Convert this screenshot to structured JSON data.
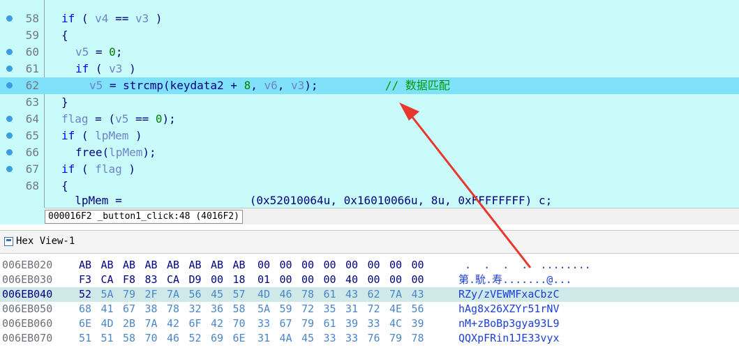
{
  "code_lines": [
    {
      "num": "58",
      "dot": true,
      "hl": false,
      "indent": 0,
      "tokens": [
        [
          "kw",
          "if"
        ],
        [
          "plain",
          " ( "
        ],
        [
          "var",
          "v4"
        ],
        [
          "plain",
          " == "
        ],
        [
          "var",
          "v3"
        ],
        [
          "plain",
          " )"
        ]
      ]
    },
    {
      "num": "59",
      "dot": false,
      "hl": false,
      "indent": 0,
      "tokens": [
        [
          "plain",
          "{"
        ]
      ]
    },
    {
      "num": "60",
      "dot": true,
      "hl": false,
      "indent": 1,
      "tokens": [
        [
          "var",
          "v5"
        ],
        [
          "plain",
          " = "
        ],
        [
          "num",
          "0"
        ],
        [
          "plain",
          ";"
        ]
      ]
    },
    {
      "num": "61",
      "dot": true,
      "hl": false,
      "indent": 1,
      "tokens": [
        [
          "kw",
          "if"
        ],
        [
          "plain",
          " ( "
        ],
        [
          "var",
          "v3"
        ],
        [
          "plain",
          " )"
        ]
      ]
    },
    {
      "num": "62",
      "dot": true,
      "hl": true,
      "indent": 2,
      "tokens": [
        [
          "var",
          "v5"
        ],
        [
          "plain",
          " = "
        ],
        [
          "func",
          "strcmp"
        ],
        [
          "plain",
          "(keydata2 + "
        ],
        [
          "num",
          "8"
        ],
        [
          "plain",
          ", "
        ],
        [
          "var",
          "v6"
        ],
        [
          "plain",
          ", "
        ],
        [
          "var",
          "v3"
        ],
        [
          "plain",
          ");          "
        ],
        [
          "cmt",
          "// 数据匹配"
        ]
      ]
    },
    {
      "num": "63",
      "dot": false,
      "hl": false,
      "indent": 0,
      "tokens": [
        [
          "plain",
          "}"
        ]
      ]
    },
    {
      "num": "64",
      "dot": true,
      "hl": false,
      "indent": 0,
      "tokens": [
        [
          "var",
          "flag"
        ],
        [
          "plain",
          " = ("
        ],
        [
          "var",
          "v5"
        ],
        [
          "plain",
          " == "
        ],
        [
          "num",
          "0"
        ],
        [
          "plain",
          ");"
        ]
      ]
    },
    {
      "num": "65",
      "dot": true,
      "hl": false,
      "indent": 0,
      "tokens": [
        [
          "kw",
          "if"
        ],
        [
          "plain",
          " ( "
        ],
        [
          "var",
          "lpMem"
        ],
        [
          "plain",
          " )"
        ]
      ]
    },
    {
      "num": "66",
      "dot": true,
      "hl": false,
      "indent": 1,
      "tokens": [
        [
          "func",
          "free"
        ],
        [
          "plain",
          "("
        ],
        [
          "var",
          "lpMem"
        ],
        [
          "plain",
          ");"
        ]
      ]
    },
    {
      "num": "67",
      "dot": true,
      "hl": false,
      "indent": 0,
      "tokens": [
        [
          "kw",
          "if"
        ],
        [
          "plain",
          " ( "
        ],
        [
          "var",
          "flag"
        ],
        [
          "plain",
          " )"
        ]
      ]
    },
    {
      "num": "68",
      "dot": false,
      "hl": false,
      "indent": 0,
      "tokens": [
        [
          "plain",
          "{"
        ]
      ]
    }
  ],
  "cut_line": "  lpMem =                   (0x52010064u, 0x16010066u, 8u, 0xFFFFFFFF) c;",
  "status_text": "000016F2 _button1_click:48 (4016F2)",
  "hex_title": "Hex View-1",
  "hex_rows": [
    {
      "addr": "006EB020",
      "hl": false,
      "bytes": [
        "AB",
        "AB",
        "AB",
        "AB",
        "AB",
        "AB",
        "AB",
        "AB",
        "00",
        "00",
        "00",
        "00",
        "00",
        "00",
        "00",
        "00"
      ],
      "ascii": " .  .  .  .  ........"
    },
    {
      "addr": "006EB030",
      "hl": false,
      "bytes": [
        "F3",
        "CA",
        "F8",
        "83",
        "CA",
        "D9",
        "00",
        "18",
        "01",
        "00",
        "00",
        "00",
        "40",
        "00",
        "00",
        "00"
      ],
      "ascii": "第.馻.寿.......@..."
    },
    {
      "addr": "006EB040",
      "hl": true,
      "bytes": [
        "52",
        "5A",
        "79",
        "2F",
        "7A",
        "56",
        "45",
        "57",
        "4D",
        "46",
        "78",
        "61",
        "43",
        "62",
        "7A",
        "43"
      ],
      "ascii": "RZy/zVEWMFxaCbzC"
    },
    {
      "addr": "006EB050",
      "hl": false,
      "bytes": [
        "68",
        "41",
        "67",
        "38",
        "78",
        "32",
        "36",
        "58",
        "5A",
        "59",
        "72",
        "35",
        "31",
        "72",
        "4E",
        "56"
      ],
      "ascii": "hAg8x26XZYr51rNV"
    },
    {
      "addr": "006EB060",
      "hl": false,
      "bytes": [
        "6E",
        "4D",
        "2B",
        "7A",
        "42",
        "6F",
        "42",
        "70",
        "33",
        "67",
        "79",
        "61",
        "39",
        "33",
        "4C",
        "39"
      ],
      "ascii": "nM+zBoBp3gya93L9"
    },
    {
      "addr": "006EB070",
      "hl": false,
      "bytes": [
        "51",
        "51",
        "58",
        "70",
        "46",
        "52",
        "69",
        "6E",
        "31",
        "4A",
        "45",
        "33",
        "33",
        "76",
        "79",
        "78"
      ],
      "ascii": "QQXpFRin1JE33vyx"
    }
  ]
}
